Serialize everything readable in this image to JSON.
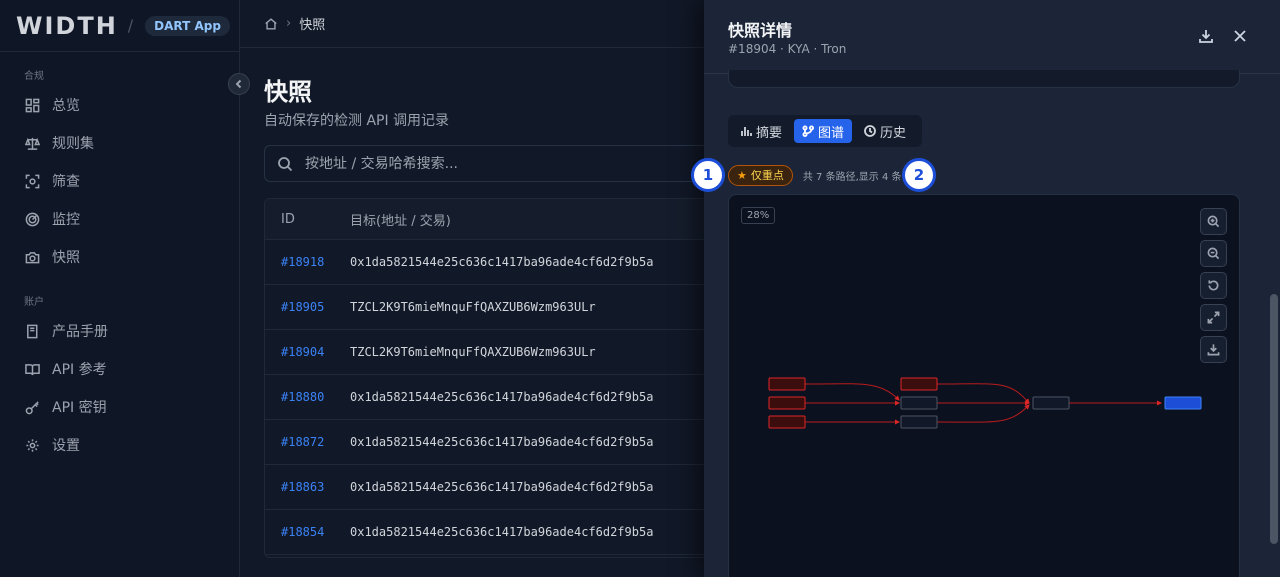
{
  "sidebar": {
    "logo": "WIDTH",
    "app_badge": "DART App",
    "sections": [
      {
        "label": "合规",
        "items": [
          {
            "label": "总览",
            "icon": "dashboard-icon"
          },
          {
            "label": "规则集",
            "icon": "scale-icon"
          },
          {
            "label": "筛查",
            "icon": "scan-icon"
          },
          {
            "label": "监控",
            "icon": "radar-icon"
          },
          {
            "label": "快照",
            "icon": "camera-icon"
          }
        ]
      },
      {
        "label": "账户",
        "items": [
          {
            "label": "产品手册",
            "icon": "book-icon"
          },
          {
            "label": "API 参考",
            "icon": "open-book-icon"
          },
          {
            "label": "API 密钥",
            "icon": "key-icon"
          },
          {
            "label": "设置",
            "icon": "gear-icon"
          }
        ]
      }
    ]
  },
  "breadcrumb": {
    "current": "快照"
  },
  "page": {
    "title": "快照",
    "subtitle": "自动保存的检测 API 调用记录",
    "search_placeholder": "按地址 / 交易哈希搜索..."
  },
  "table": {
    "columns": [
      "ID",
      "目标(地址 / 交易)"
    ],
    "rows": [
      {
        "id": "#18918",
        "target": "0x1da5821544e25c636c1417ba96ade4cf6d2f9b5a"
      },
      {
        "id": "#18905",
        "target": "TZCL2K9T6mieMnquFfQAXZUB6Wzm963ULr"
      },
      {
        "id": "#18904",
        "target": "TZCL2K9T6mieMnquFfQAXZUB6Wzm963ULr"
      },
      {
        "id": "#18880",
        "target": "0x1da5821544e25c636c1417ba96ade4cf6d2f9b5a"
      },
      {
        "id": "#18872",
        "target": "0x1da5821544e25c636c1417ba96ade4cf6d2f9b5a"
      },
      {
        "id": "#18863",
        "target": "0x1da5821544e25c636c1417ba96ade4cf6d2f9b5a"
      },
      {
        "id": "#18854",
        "target": "0x1da5821544e25c636c1417ba96ade4cf6d2f9b5a"
      }
    ]
  },
  "drawer": {
    "title": "快照详情",
    "subtitle": "#18904 · KYA · Tron",
    "tabs": [
      {
        "label": "摘要",
        "icon": "bar-chart-icon",
        "active": false
      },
      {
        "label": "图谱",
        "icon": "graph-icon",
        "active": true
      },
      {
        "label": "历史",
        "icon": "clock-icon",
        "active": false
      }
    ],
    "key_only_label": "仅重点",
    "paths_text": "共 7 条路径,显示 4 条",
    "zoom": "28%"
  },
  "markers": [
    "1",
    "2"
  ],
  "colors": {
    "accent": "#2563eb",
    "risk_red": "#dc2626",
    "link_blue": "#3b82f6",
    "warning": "#f59e0b"
  }
}
